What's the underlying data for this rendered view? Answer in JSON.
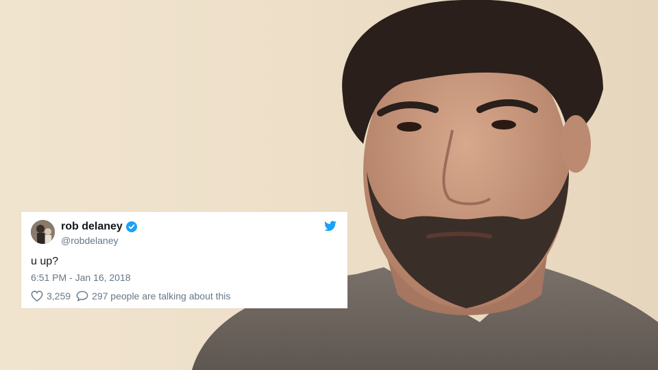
{
  "tweet": {
    "display_name": "rob delaney",
    "handle": "@robdelaney",
    "text": "u up?",
    "timestamp": "6:51 PM - Jan 16, 2018",
    "likes": "3,259",
    "replies_text": "297 people are talking about this",
    "verified": true,
    "brand_color": "#1da1f2",
    "icons": [
      "verified-badge-icon",
      "twitter-bird-icon",
      "heart-icon",
      "comment-icon"
    ]
  },
  "colors": {
    "card_bg": "#ffffff",
    "text_primary": "#14171a",
    "text_secondary": "#657786",
    "wall": "#efe2cd",
    "shirt": "#6b625b",
    "hair": "#2a1f1a"
  }
}
